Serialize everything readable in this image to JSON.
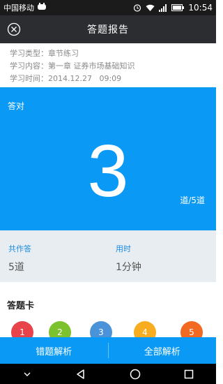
{
  "status_bar": {
    "carrier": "中国移动",
    "time": "10:54"
  },
  "header": {
    "title": "答题报告"
  },
  "info": {
    "type_label": "学习类型：",
    "type_value": "章节练习",
    "content_label": "学习内容：",
    "content_value": "第一章 证券市场基础知识",
    "time_label": "学习时间：",
    "time_value": "2014.12.27   09:09"
  },
  "score": {
    "label": "答对",
    "correct": "3",
    "total_text": "道/5道"
  },
  "stats": {
    "answered_label": "共作答",
    "answered_value": "5道",
    "duration_label": "用时",
    "duration_value": "1分钟"
  },
  "answer_card": {
    "title": "答题卡",
    "items": [
      {
        "number": "1",
        "color": "#e8424a"
      },
      {
        "number": "2",
        "color": "#7cc22f"
      },
      {
        "number": "3",
        "color": "#4a93d9"
      },
      {
        "number": "4",
        "color": "#f7ad1f"
      },
      {
        "number": "5",
        "color": "#f26a21"
      }
    ]
  },
  "actions": {
    "wrong_analysis": "错题解析",
    "all_analysis": "全部解析"
  },
  "colors": {
    "accent": "#0a9af6",
    "title_bar": "#2b2d31"
  }
}
